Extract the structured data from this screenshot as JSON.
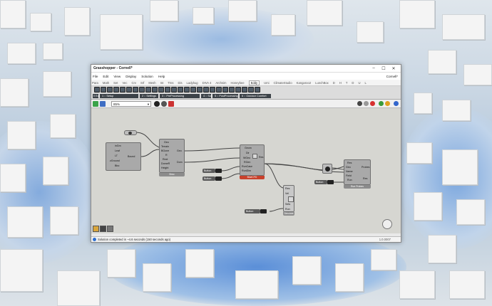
{
  "window": {
    "title": "Grasshopper - Cornell*",
    "doc_name": "Cornell*",
    "controls": [
      "–",
      "☐",
      "✕"
    ]
  },
  "menu": [
    "File",
    "Edit",
    "View",
    "Display",
    "Solution",
    "Help"
  ],
  "tabs": [
    "Para",
    "Math",
    "Set",
    "Vec",
    "Crv",
    "Srf",
    "Mesh",
    "Int",
    "Trns",
    "Dis",
    "Ladybug",
    "DIVA 4",
    "Archsim",
    "Honeybee",
    "Eddy",
    "Umi",
    "ClimateStudio",
    "Kangaroo2",
    "LunchBox",
    "D",
    "H",
    "T",
    "D",
    "U",
    "L"
  ],
  "active_tab": "Eddy",
  "ribbon": {
    "left_label": "0 Eddy",
    "groups": [
      "1 :: Setup",
      "2 :: Settings",
      "3 :: PreProcessing",
      "4 :: Solvers",
      "5 :: PostProcessing",
      "6 :: Outdoor Comfort"
    ]
  },
  "toolbar": {
    "zoom": "85%"
  },
  "canvas": {
    "comp_a": {
      "inputs": [
        "inGm",
        "Leaf",
        "LT",
        "zGround",
        "Bbo"
      ],
      "output": "Bound"
    },
    "comp_b": {
      "inputs": [
        "Geo",
        "Terrain",
        "BGone",
        "R",
        "Rext",
        "DomeR",
        "Height"
      ],
      "outputs": [
        "Geo",
        "Dom"
      ],
      "footer": "Bmo"
    },
    "comp_c": {
      "inputs": [
        "Geom",
        "Dir",
        "WGeo",
        "RGen",
        "RunCase",
        "RunDim"
      ],
      "output": "Res",
      "footer": "BlueCFD"
    },
    "comp_d": {
      "inputs": [
        "Res",
        "Vel",
        "Sets",
        "Run"
      ],
      "footer": "Simulate"
    },
    "comp_e": {
      "inputs": [
        "Res",
        "Geo",
        "Name",
        "Field",
        "Run"
      ],
      "outputs": [
        "Probes",
        "Res"
      ],
      "footer": "Run Probes"
    },
    "toggles": [
      "Button",
      "Button",
      "Button",
      "Button"
    ]
  },
  "status": {
    "message": "Solution completed in ~4.6 seconds (150 seconds ago)",
    "version": "1.0.0007"
  }
}
